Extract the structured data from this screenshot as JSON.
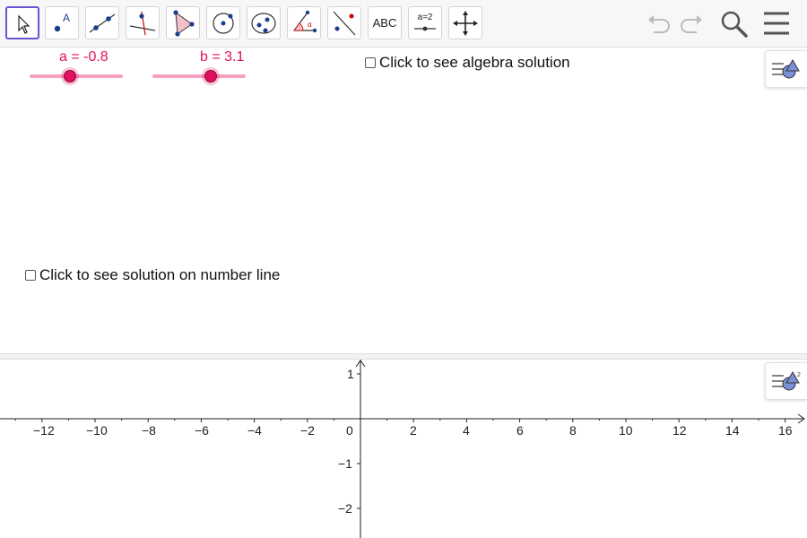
{
  "toolbar": {
    "tools": [
      {
        "name": "move-tool",
        "label": ""
      },
      {
        "name": "point-tool",
        "label": ""
      },
      {
        "name": "line-tool",
        "label": ""
      },
      {
        "name": "perpendicular-line-tool",
        "label": ""
      },
      {
        "name": "polygon-tool",
        "label": ""
      },
      {
        "name": "circle-center-point-tool",
        "label": ""
      },
      {
        "name": "ellipse-tool",
        "label": ""
      },
      {
        "name": "angle-tool",
        "label": ""
      },
      {
        "name": "reflect-tool",
        "label": ""
      },
      {
        "name": "text-tool",
        "label": "ABC"
      },
      {
        "name": "slider-tool",
        "label": "a=2"
      },
      {
        "name": "move-graphics-view-tool",
        "label": ""
      }
    ],
    "right_icons": [
      "undo-icon",
      "redo-icon",
      "search-icon",
      "menu-icon"
    ]
  },
  "sliders": [
    {
      "label": "a = -0.8",
      "value": -0.8
    },
    {
      "label": "b = 3.1",
      "value": 3.1
    }
  ],
  "checkboxes": {
    "algebra": "Click to see algebra solution",
    "number_line": "Click to see solution on number line"
  },
  "axes": {
    "x_ticks": [
      "−12",
      "−10",
      "−8",
      "−6",
      "−4",
      "−2",
      "0",
      "2",
      "4",
      "6",
      "8",
      "10",
      "12",
      "14",
      "16"
    ],
    "y_ticks": [
      "1",
      "−1",
      "−2"
    ]
  },
  "colors": {
    "slider": "#e0115f",
    "active_tool_border": "#6557d2"
  }
}
